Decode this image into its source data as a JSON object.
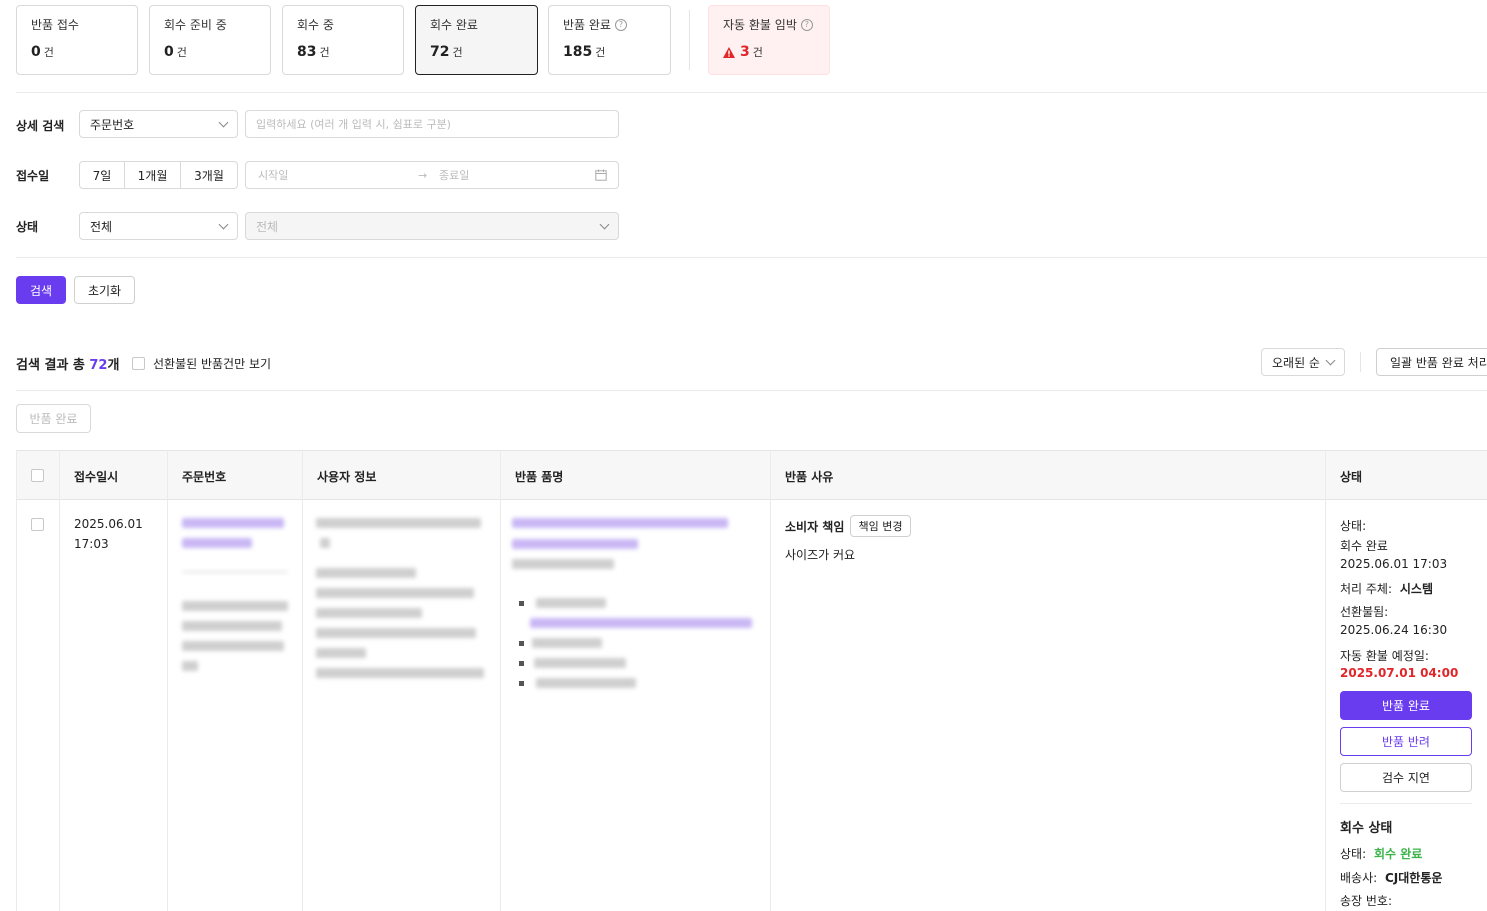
{
  "status_cards": [
    {
      "label": "반품 접수",
      "count": "0",
      "unit": "건"
    },
    {
      "label": "회수 준비 중",
      "count": "0",
      "unit": "건"
    },
    {
      "label": "회수 중",
      "count": "83",
      "unit": "건"
    },
    {
      "label": "회수 완료",
      "count": "72",
      "unit": "건"
    },
    {
      "label": "반품 완료",
      "count": "185",
      "unit": "건"
    },
    {
      "label": "자동 환불 임박",
      "count": "3",
      "unit": "건"
    }
  ],
  "filters": {
    "detail_search_label": "상세 검색",
    "search_field_value": "주문번호",
    "search_placeholder": "입력하세요 (여러 개 입력 시, 쉼표로 구분)",
    "date_label": "접수일",
    "date_ranges": [
      "7일",
      "1개월",
      "3개월"
    ],
    "start_placeholder": "시작일",
    "end_placeholder": "종료일",
    "status_label": "상태",
    "status_value": "전체",
    "substatus_value": "전체"
  },
  "actions": {
    "search": "검색",
    "reset": "초기화"
  },
  "results": {
    "prefix": "검색 결과 총 ",
    "count": "72",
    "suffix": "개",
    "prepaid_only_label": "선환불된 반품건만 보기",
    "sort_value": "오래된 순",
    "bulk_complete": "일괄 반품 완료 처리",
    "complete_selected": "반품 완료"
  },
  "table": {
    "headers": [
      "접수일시",
      "주문번호",
      "사용자 정보",
      "반품 품명",
      "반품 사유",
      "상태"
    ],
    "row": {
      "received_date": "2025.06.01",
      "received_time": "17:03",
      "reason_fault": "소비자 책임",
      "change_fault": "책임 변경",
      "reason_text": "사이즈가 커요",
      "status_label": "상태:",
      "status_value": "회수 완료",
      "status_time": "2025.06.01 17:03",
      "handler_label": "처리 주체:",
      "handler_value": "시스템",
      "prepaid_label": "선환불됨:",
      "prepaid_time": "2025.06.24 16:30",
      "auto_refund_label": "자동 환불 예정일:",
      "auto_refund_time": "2025.07.01 04:00",
      "btn_complete": "반품 완료",
      "btn_reject": "반품 반려",
      "btn_delay": "검수 지연",
      "pickup_title": "회수 상태",
      "pickup_status_label": "상태:",
      "pickup_status_value": "회수 완료",
      "carrier_label": "배송사:",
      "carrier_value": "CJ대한통운",
      "tracking_label": "송장 번호:"
    }
  },
  "colors": {
    "accent": "#6a3cf0",
    "danger": "#e0262b",
    "success": "#3cb44b"
  }
}
